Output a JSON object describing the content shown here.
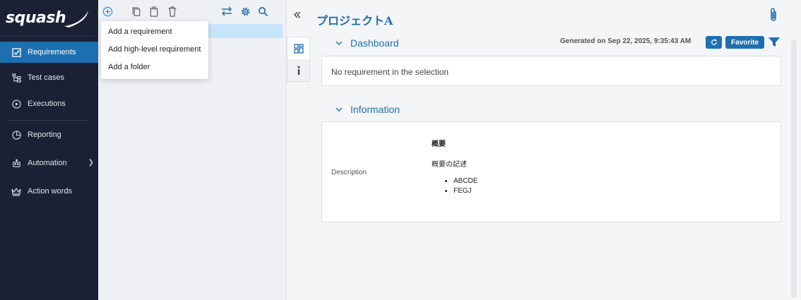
{
  "app": {
    "logo_text": "squash"
  },
  "nav": {
    "items": [
      {
        "label": "Requirements",
        "icon": "checkbox-icon"
      },
      {
        "label": "Test cases",
        "icon": "tree-icon"
      },
      {
        "label": "Executions",
        "icon": "play-circle-icon"
      },
      {
        "label": "Reporting",
        "icon": "pie-chart-icon"
      },
      {
        "label": "Automation",
        "icon": "robot-icon"
      },
      {
        "label": "Action words",
        "icon": "crown-icon"
      }
    ]
  },
  "dropdown": {
    "items": [
      "Add a requirement",
      "Add high-level requirement",
      "Add a folder"
    ]
  },
  "main": {
    "project_title": "プロジェクトA",
    "dashboard": {
      "title": "Dashboard",
      "generated": "Generated on Sep 22, 2025, 9:35:43 AM",
      "favorite_label": "Favorite",
      "empty_message": "No requirement in the selection"
    },
    "information": {
      "title": "Information",
      "description_label": "Description",
      "description_heading": "概要",
      "description_text": "概要の記述",
      "description_items": [
        "ABCDE",
        "FEGJ"
      ]
    }
  },
  "colors": {
    "accent": "#1e6fb0",
    "nav_bg": "#1b2135",
    "selection": "#c6e5fb"
  }
}
